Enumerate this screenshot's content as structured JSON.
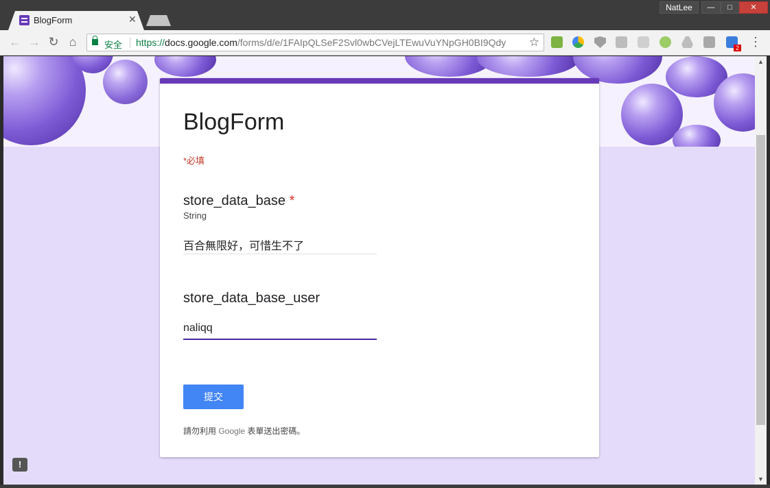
{
  "browser": {
    "tab_title": "BlogForm",
    "tab_close": "✕",
    "profile_name": "NatLee",
    "window_min": "—",
    "window_max": "□",
    "window_close": "✕",
    "secure_label": "安全",
    "url_scheme": "https://",
    "url_host": "docs.google.com",
    "url_path": "/forms/d/e/1FAIpQLSeF2Svl0wbCVejLTEwuVuYNpGH0BI9Qdy",
    "extension_badge": "2",
    "extensions": [
      "pushbullet-icon",
      "drive-color-icon",
      "shield-icon",
      "screen-capture-icon",
      "camera-icon",
      "chat-bubble-icon",
      "drive-icon",
      "pdf-icon",
      "translate-icon"
    ]
  },
  "form": {
    "title": "BlogForm",
    "required_note": "*必填",
    "questions": [
      {
        "title": "store_data_base",
        "required_mark": "*",
        "description": "String",
        "answer": "百合無限好，可惜生不了"
      },
      {
        "title": "store_data_base_user",
        "answer": "naliqq"
      }
    ],
    "submit_label": "提交",
    "footer_prefix": "請勿利用 ",
    "footer_brand": "Google",
    "footer_suffix": " 表單送出密碼。"
  },
  "colors": {
    "theme": "#673ab7",
    "background": "#e4dbfb",
    "submit": "#4285f4",
    "required": "#c53929"
  },
  "feedback_icon_glyph": "!"
}
